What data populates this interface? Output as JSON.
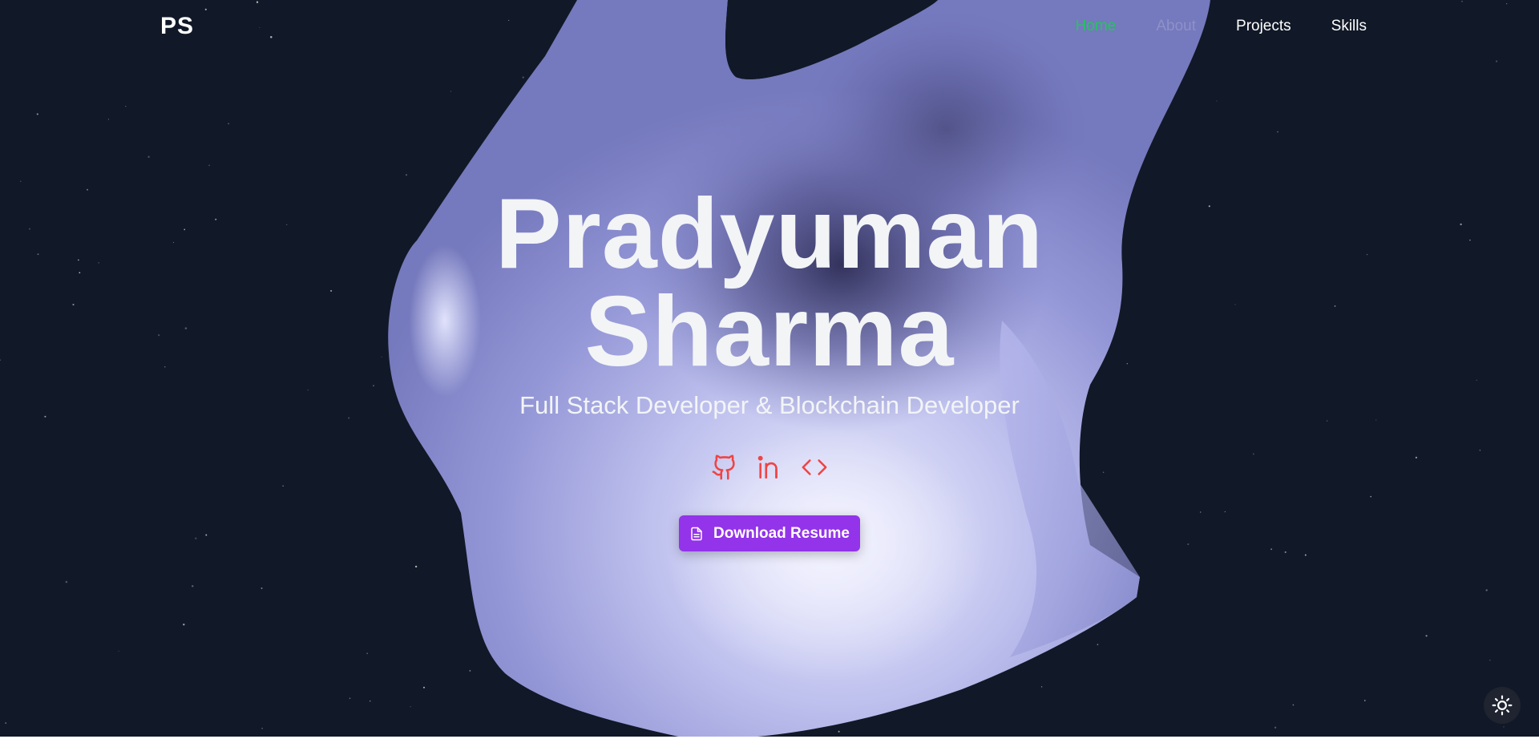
{
  "nav": {
    "logo": "PS",
    "links": [
      {
        "label": "Home",
        "state": "active"
      },
      {
        "label": "About",
        "state": "faded"
      },
      {
        "label": "Projects",
        "state": "normal"
      },
      {
        "label": "Skills",
        "state": "normal"
      }
    ],
    "active_color": "#22c55e"
  },
  "hero": {
    "name_line1": "Pradyuman",
    "name_line2": "Sharma",
    "subtitle": "Full Stack Developer & Blockchain Developer",
    "socials": [
      {
        "icon": "github-icon"
      },
      {
        "icon": "linkedin-icon"
      },
      {
        "icon": "code-icon"
      }
    ],
    "social_color": "#ef4444",
    "resume_button": {
      "label": "Download Resume",
      "icon": "file-icon",
      "color": "#9333ea"
    }
  },
  "theme_toggle": {
    "icon": "sun-icon"
  },
  "colors": {
    "background": "#111827",
    "blob": "#a5a8e6",
    "text": "#f3f4f6"
  }
}
